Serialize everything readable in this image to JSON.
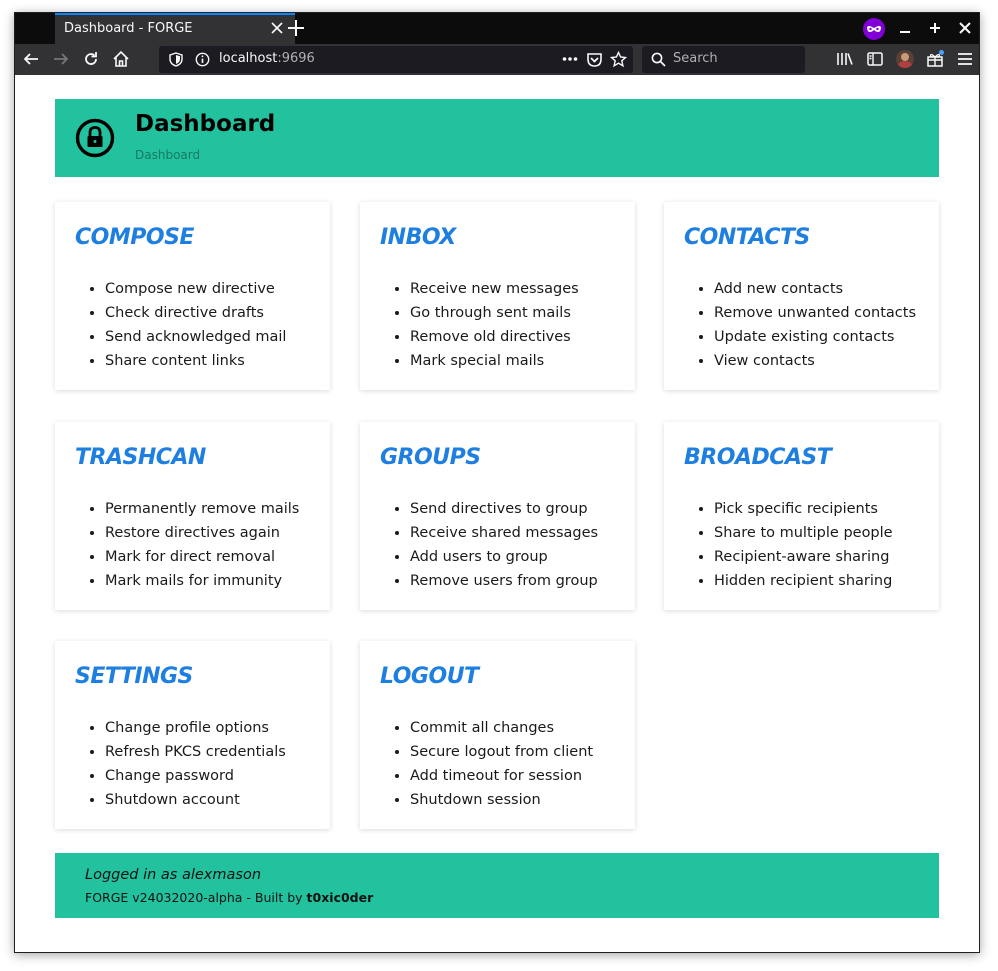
{
  "browser": {
    "tab_title": "Dashboard - FORGE",
    "url_host": "localhost",
    "url_port": ":9696",
    "search_placeholder": "Search"
  },
  "colors": {
    "accent": "#23c29f",
    "card_title": "#1e7fe0",
    "private_mask": "#8000d7"
  },
  "header": {
    "title": "Dashboard",
    "breadcrumb": "Dashboard",
    "icon": "lock-icon"
  },
  "cards": [
    {
      "title": "COMPOSE",
      "items": [
        "Compose new directive",
        "Check directive drafts",
        "Send acknowledged mail",
        "Share content links"
      ]
    },
    {
      "title": "INBOX",
      "items": [
        "Receive new messages",
        "Go through sent mails",
        "Remove old directives",
        "Mark special mails"
      ]
    },
    {
      "title": "CONTACTS",
      "items": [
        "Add new contacts",
        "Remove unwanted contacts",
        "Update existing contacts",
        "View contacts"
      ]
    },
    {
      "title": "TRASHCAN",
      "items": [
        "Permanently remove mails",
        "Restore directives again",
        "Mark for direct removal",
        "Mark mails for immunity"
      ]
    },
    {
      "title": "GROUPS",
      "items": [
        "Send directives to group",
        "Receive shared messages",
        "Add users to group",
        "Remove users from group"
      ]
    },
    {
      "title": "BROADCAST",
      "items": [
        "Pick specific recipients",
        "Share to multiple people",
        "Recipient-aware sharing",
        "Hidden recipient sharing"
      ]
    },
    {
      "title": "SETTINGS",
      "items": [
        "Change profile options",
        "Refresh PKCS credentials",
        "Change password",
        "Shutdown account"
      ]
    },
    {
      "title": "LOGOUT",
      "items": [
        "Commit all changes",
        "Secure logout from client",
        "Add timeout for session",
        "Shutdown session"
      ]
    }
  ],
  "footer": {
    "login_text": "Logged in as alexmason",
    "build_prefix": "FORGE v24032020-alpha - Built by ",
    "author": "t0xic0der"
  }
}
